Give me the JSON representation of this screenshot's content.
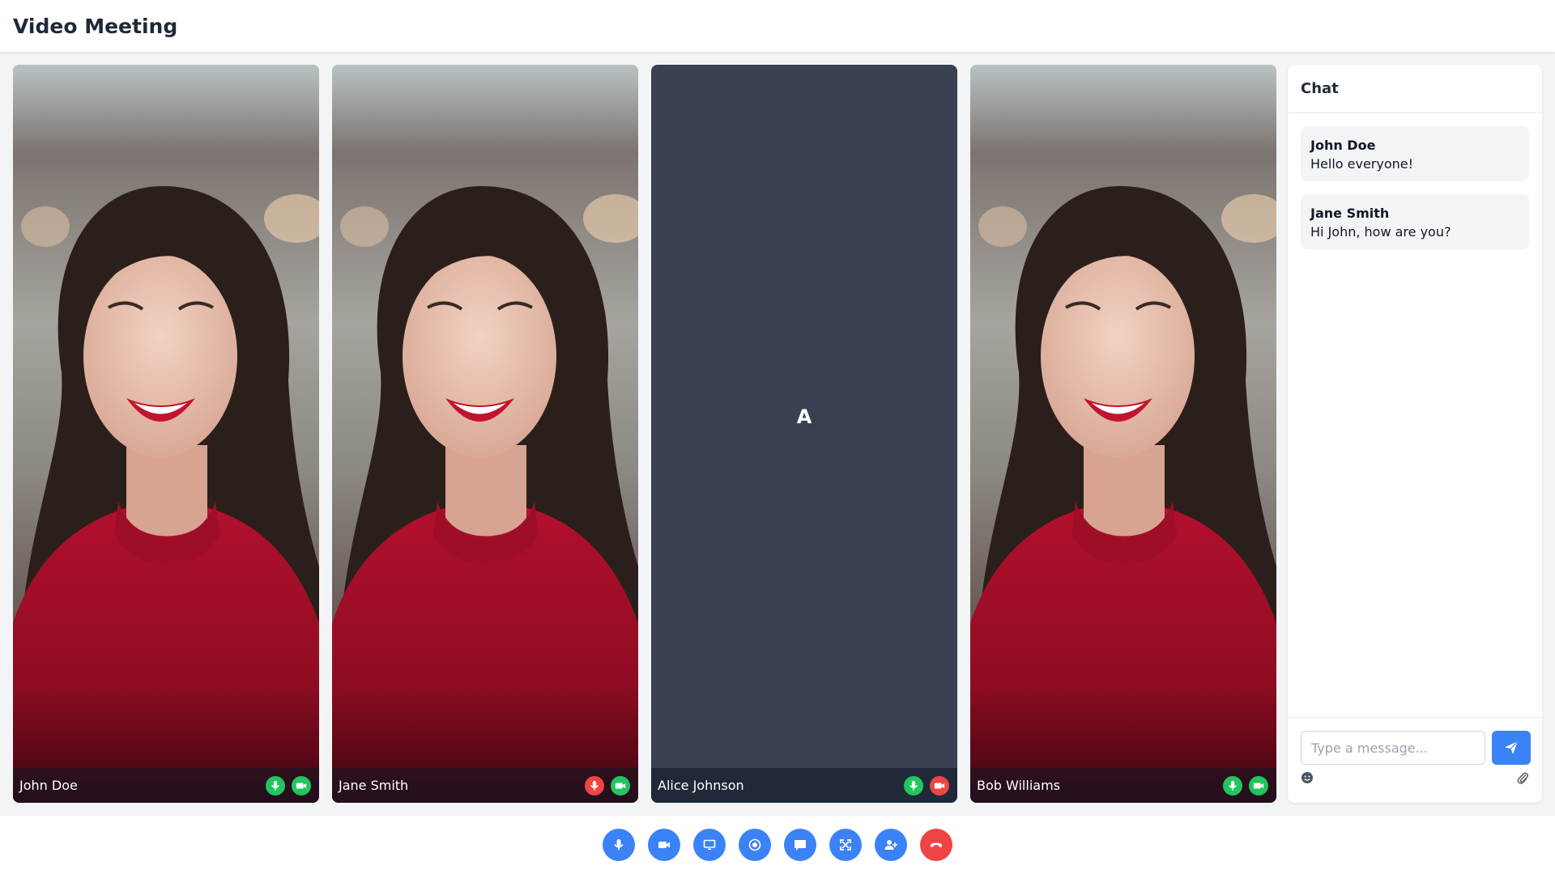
{
  "header": {
    "title": "Video Meeting"
  },
  "participants": [
    {
      "name": "John Doe",
      "mic": "on",
      "camera": "on",
      "avatar_letter": ""
    },
    {
      "name": "Jane Smith",
      "mic": "off",
      "camera": "on",
      "avatar_letter": ""
    },
    {
      "name": "Alice Johnson",
      "mic": "on",
      "camera": "off",
      "avatar_letter": "A"
    },
    {
      "name": "Bob Williams",
      "mic": "on",
      "camera": "on",
      "avatar_letter": ""
    }
  ],
  "chat": {
    "title": "Chat",
    "messages": [
      {
        "author": "John Doe",
        "text": "Hello everyone!"
      },
      {
        "author": "Jane Smith",
        "text": "Hi John, how are you?"
      }
    ],
    "input_placeholder": "Type a message...",
    "input_value": ""
  },
  "controls": [
    {
      "icon": "microphone-icon"
    },
    {
      "icon": "video-camera-icon"
    },
    {
      "icon": "screen-share-icon"
    },
    {
      "icon": "record-icon"
    },
    {
      "icon": "chat-icon"
    },
    {
      "icon": "fullscreen-icon"
    },
    {
      "icon": "add-participant-icon"
    },
    {
      "icon": "end-call-icon"
    }
  ],
  "colors": {
    "accent": "#3b82f6",
    "status_on": "#22c55e",
    "status_off": "#ef4444",
    "tile_background": "#374151"
  }
}
